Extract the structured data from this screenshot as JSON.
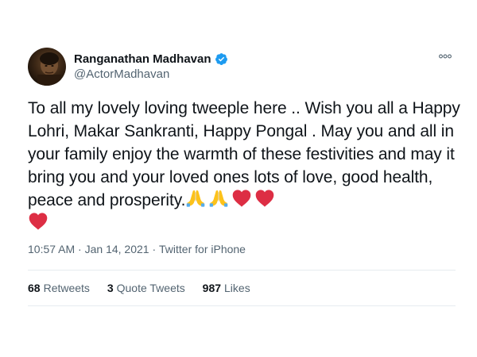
{
  "tweet": {
    "display_name": "Ranganathan Madhavan",
    "handle": "@ActorMadhavan",
    "text": "To all my lovely loving tweeple here .. Wish you all a Happy Lohri, Makar Sankranti, Happy Pongal . May you and all in your family enjoy the warmth of these festivities and may it bring you and your loved ones lots of love, good health, peace and prosperity.",
    "emojis": [
      "folded-hands",
      "folded-hands",
      "red-heart",
      "red-heart",
      "red-heart"
    ],
    "time": "10:57 AM",
    "date": "Jan 14, 2021",
    "source": "Twitter for iPhone",
    "separator": "·",
    "stats": {
      "retweets_count": "68",
      "retweets_label": "Retweets",
      "quote_count": "3",
      "quote_label": "Quote Tweets",
      "likes_count": "987",
      "likes_label": "Likes"
    }
  },
  "icons": {
    "verified": "verified-badge-icon",
    "more": "more-options-icon"
  },
  "colors": {
    "verified_blue": "#1d9bf0",
    "secondary_text": "#536471",
    "primary_text": "#0f1419",
    "heart_red": "#dd2e44",
    "hands_yellow": "#fcc21b",
    "divider": "#e6ecf0"
  }
}
